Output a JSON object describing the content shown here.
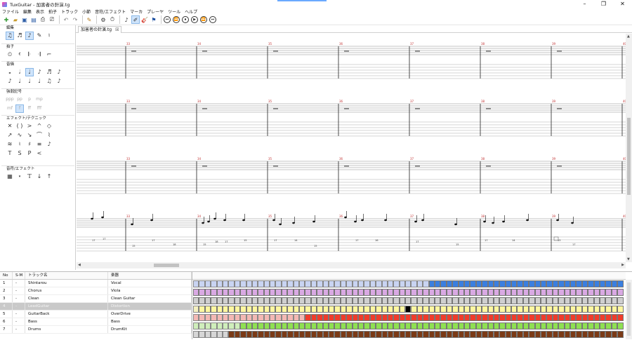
{
  "window": {
    "title": "TuxGuitar - 加害者の針演.tg",
    "min": "–",
    "max": "❐",
    "close": "✕"
  },
  "menu": [
    "ファイル",
    "編集",
    "表示",
    "拍子",
    "トラック",
    "小節",
    "音符/エフェクト",
    "マーカ",
    "プレーヤ",
    "ツール",
    "ヘルプ"
  ],
  "toolbar": {
    "file_icons": [
      "new-file-icon",
      "open-file-icon",
      "save-icon",
      "save-as-icon",
      "print-icon",
      "print-preview-icon"
    ],
    "edit_icons": [
      "undo-icon",
      "redo-icon",
      "pencil-icon"
    ],
    "transport": [
      "⏮",
      "⏪",
      "⏹",
      "▶",
      "⏩",
      "⏭"
    ]
  },
  "left_panel": {
    "sections": [
      {
        "title": "編集"
      },
      {
        "title": "拍子"
      },
      {
        "title": "音価"
      },
      {
        "title": "強弱記号",
        "dyn1": [
          "ppp",
          "pp",
          "p",
          "mp"
        ],
        "dyn2": [
          "mf",
          "f",
          "ff",
          "fff"
        ]
      },
      {
        "title": "エフェクト/テクニック",
        "r3": [
          "T",
          "S",
          "P",
          "<"
        ]
      },
      {
        "title": "音符/エフェクト"
      }
    ]
  },
  "tab": {
    "label": "加害者の針演.tg",
    "close": "☒"
  },
  "score": {
    "measure_numbers_row1": [
      "33",
      "34",
      "35",
      "36",
      "37",
      "38",
      "39",
      "40"
    ],
    "measure_numbers_row2": [
      "33",
      "34",
      "35",
      "36",
      "37",
      "38",
      "39",
      "40"
    ],
    "measure_numbers_row3": [
      "33",
      "34",
      "35",
      "36",
      "37",
      "38",
      "39",
      "40"
    ],
    "measure_numbers_row4": [
      "33",
      "34",
      "35",
      "36",
      "37",
      "38",
      "39",
      "40"
    ],
    "tab_numbers": [
      "17",
      "17",
      "15",
      "17",
      "18",
      "15",
      "18",
      "17",
      "15",
      "17",
      "14",
      "15",
      "17",
      "16",
      "17",
      "15",
      "17",
      "14",
      "15",
      "17"
    ]
  },
  "tracks": {
    "headers": [
      "No",
      "S-M",
      "トラック名",
      "楽器"
    ],
    "rows": [
      {
        "no": "1",
        "sm": "-",
        "name": "Shintarou",
        "instrument": "Vocal",
        "color": "#3a7fe0",
        "light": "#c9d4f2",
        "start": 40
      },
      {
        "no": "2",
        "sm": "-",
        "name": "Chorus",
        "instrument": "Viola",
        "color": "#d9a9e3",
        "light": "#e6cfe9",
        "start": 0
      },
      {
        "no": "3",
        "sm": "-",
        "name": "Clean",
        "instrument": "Clean Guitar",
        "color": "#cfcfcf",
        "light": "#e3e3e3",
        "start": 0
      },
      {
        "no": "4",
        "sm": "-",
        "name": "LeadGuitar",
        "instrument": "Distortion",
        "color": "#fff7a0",
        "light": "#f4f0c0",
        "start": 1
      },
      {
        "no": "5",
        "sm": "-",
        "name": "GuitarBack",
        "instrument": "OverDrive",
        "color": "#f03c2c",
        "light": "#f3b8b4",
        "start": 19
      },
      {
        "no": "6",
        "sm": "-",
        "name": "Bass",
        "instrument": "Bass",
        "color": "#8fe052",
        "light": "#cfeebb",
        "start": 8
      },
      {
        "no": "7",
        "sm": "-",
        "name": "Drums",
        "instrument": "DrumKit",
        "color": "#7b3a16",
        "light": "#d6d6d6",
        "start": 6
      }
    ]
  }
}
